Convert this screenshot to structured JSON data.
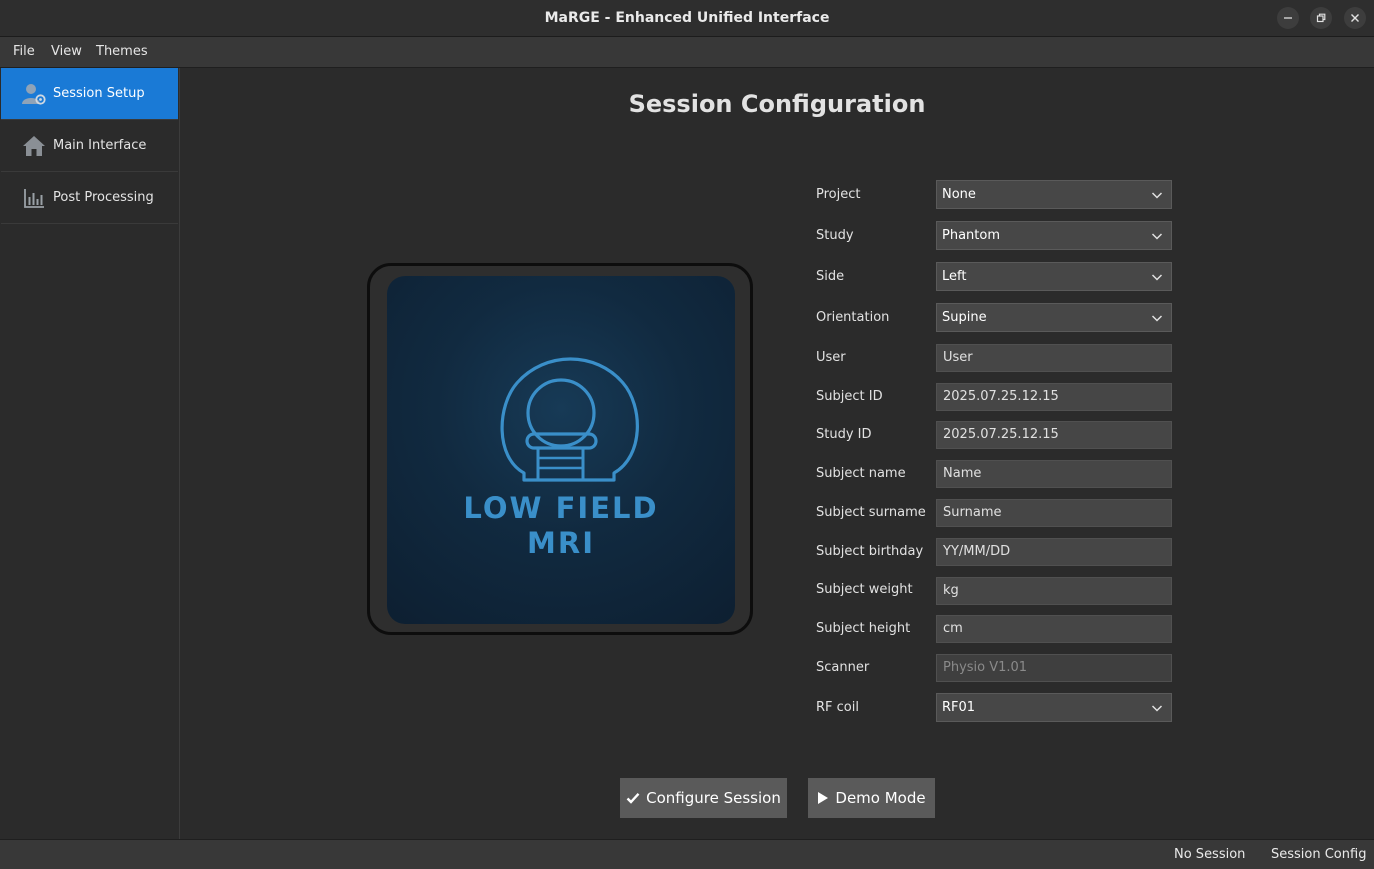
{
  "window": {
    "title": "MaRGE - Enhanced Unified Interface",
    "controls": [
      "minimize-icon",
      "restore-icon",
      "close-icon"
    ]
  },
  "menubar": {
    "items": [
      "File",
      "View",
      "Themes"
    ]
  },
  "sidebar": {
    "items": [
      {
        "label": "Session Setup",
        "icon": "user-settings-icon",
        "active": true
      },
      {
        "label": "Main Interface",
        "icon": "home-icon",
        "active": false
      },
      {
        "label": "Post Processing",
        "icon": "bar-chart-icon",
        "active": false
      }
    ]
  },
  "main": {
    "title": "Session Configuration",
    "logo": {
      "line1": "LOW FIELD",
      "line2": "MRI",
      "icon": "mri-scanner-icon"
    },
    "form": {
      "project": {
        "label": "Project",
        "value": "None"
      },
      "study": {
        "label": "Study",
        "value": "Phantom"
      },
      "side": {
        "label": "Side",
        "value": "Left"
      },
      "orientation": {
        "label": "Orientation",
        "value": "Supine"
      },
      "user": {
        "label": "User",
        "value": "User"
      },
      "subject_id": {
        "label": "Subject ID",
        "value": "2025.07.25.12.15"
      },
      "study_id": {
        "label": "Study ID",
        "value": "2025.07.25.12.15"
      },
      "subject_name": {
        "label": "Subject name",
        "value": "Name"
      },
      "subject_surname": {
        "label": "Subject surname",
        "value": "Surname"
      },
      "subject_birthday": {
        "label": "Subject birthday",
        "value": "YY/MM/DD"
      },
      "subject_weight": {
        "label": "Subject weight",
        "value": "kg"
      },
      "subject_height": {
        "label": "Subject height",
        "value": "cm"
      },
      "scanner": {
        "label": "Scanner",
        "value": "Physio V1.01"
      },
      "rf_coil": {
        "label": "RF coil",
        "value": "RF01"
      }
    },
    "buttons": {
      "configure": "Configure Session",
      "demo": "Demo Mode"
    }
  },
  "statusbar": {
    "session": "No Session",
    "mode": "Session Config"
  },
  "colors": {
    "accent": "#1a7ad6",
    "background": "#2b2b2b",
    "logo_blue": "#3a8fc9"
  }
}
